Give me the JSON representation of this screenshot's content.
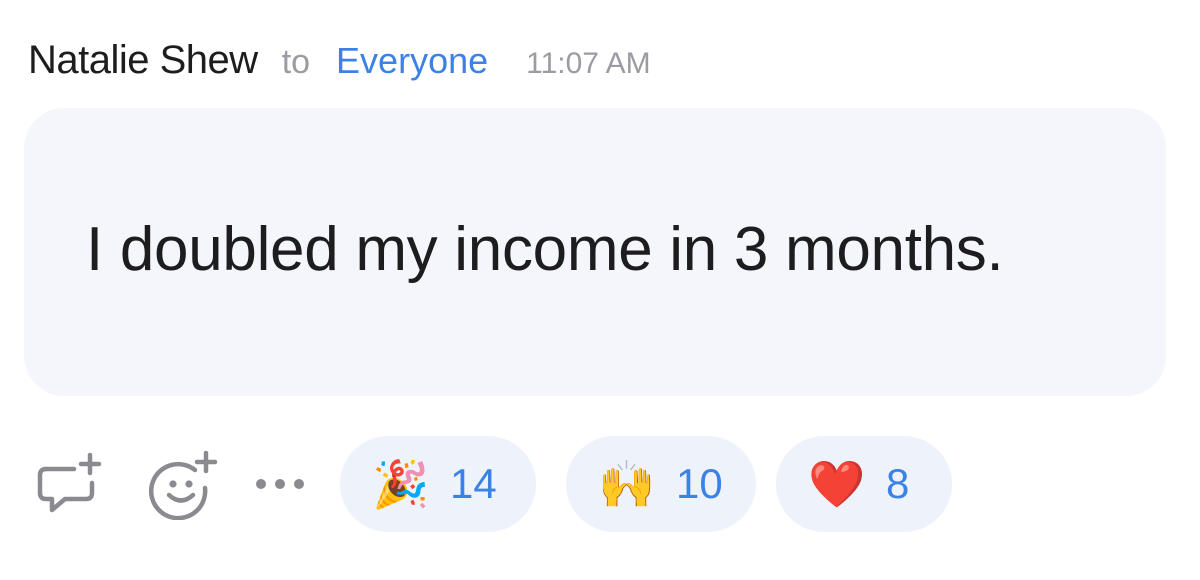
{
  "message": {
    "sender": "Natalie Shew",
    "to_word": "to",
    "recipient": "Everyone",
    "time": "11:07 AM",
    "text": "I doubled my income in 3 months."
  },
  "actions": {
    "reply_icon": "comment-plus-icon",
    "emoji_icon": "smiley-plus-icon",
    "more_icon": "ellipsis-icon",
    "more_label": "•••"
  },
  "reactions": [
    {
      "emoji": "🎉",
      "name": "party-popper",
      "count": "14"
    },
    {
      "emoji": "🙌",
      "name": "raised-hands",
      "count": "10"
    },
    {
      "emoji": "❤️",
      "name": "red-heart",
      "count": "8"
    }
  ],
  "colors": {
    "accent": "#3c82e6",
    "muted": "#9b9ba3",
    "bubble": "#f4f6fb",
    "reaction_bg": "#eef3fb",
    "text": "#1d1d1f",
    "icon": "#8a8a90"
  }
}
